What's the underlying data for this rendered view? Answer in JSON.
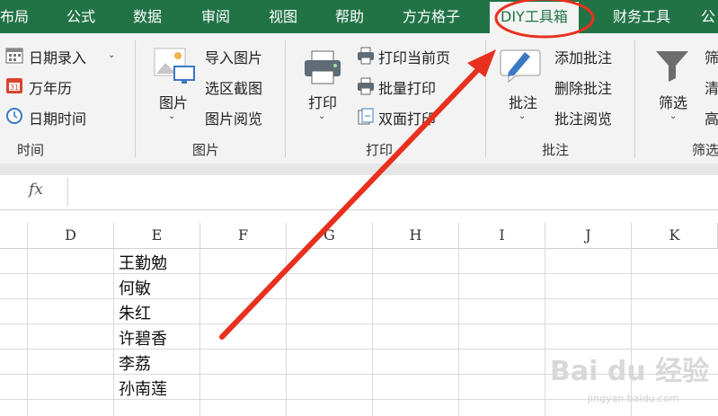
{
  "tabs": [
    {
      "label": "布局",
      "active": false
    },
    {
      "label": "公式",
      "active": false
    },
    {
      "label": "数据",
      "active": false
    },
    {
      "label": "审阅",
      "active": false
    },
    {
      "label": "视图",
      "active": false
    },
    {
      "label": "帮助",
      "active": false
    },
    {
      "label": "方方格子",
      "active": false
    },
    {
      "label": "DIY工具箱",
      "active": true
    },
    {
      "label": "财务工具",
      "active": false
    },
    {
      "label": "公",
      "active": false
    }
  ],
  "ribbon": {
    "time_group": {
      "label": "时间",
      "items": [
        {
          "label": "日期录入",
          "icon": "calendar-grid-icon"
        },
        {
          "label": "万年历",
          "icon": "calendar-icon"
        },
        {
          "label": "日期时间",
          "icon": "clock-icon"
        }
      ]
    },
    "picture_group": {
      "label": "图片",
      "big": "图片",
      "items": [
        {
          "label": "导入图片"
        },
        {
          "label": "选区截图"
        },
        {
          "label": "图片阅览"
        }
      ]
    },
    "print_group": {
      "label": "打印",
      "big": "打印",
      "items": [
        {
          "label": "打印当前页"
        },
        {
          "label": "批量打印"
        },
        {
          "label": "双面打印"
        }
      ]
    },
    "comment_group": {
      "label": "批注",
      "big": "批注",
      "items": [
        {
          "label": "添加批注"
        },
        {
          "label": "删除批注"
        },
        {
          "label": "批注阅览"
        }
      ]
    },
    "filter_group": {
      "label": "筛选",
      "big": "筛选",
      "items": [
        {
          "label": "筛"
        },
        {
          "label": "清"
        },
        {
          "label": "高"
        }
      ]
    }
  },
  "formula_bar": {
    "fx": "fx",
    "value": ""
  },
  "columns": [
    "D",
    "E",
    "F",
    "G",
    "H",
    "I",
    "J",
    "K"
  ],
  "cells": [
    "王勤勉",
    "何敏",
    "朱红",
    "许碧香",
    "李荔",
    "孙南莲"
  ],
  "watermark": {
    "main": "Bai du 经验",
    "sub": "jingyan.baidu.com"
  },
  "colors": {
    "excel_green": "#217346",
    "annotation_red": "#e8301f"
  }
}
